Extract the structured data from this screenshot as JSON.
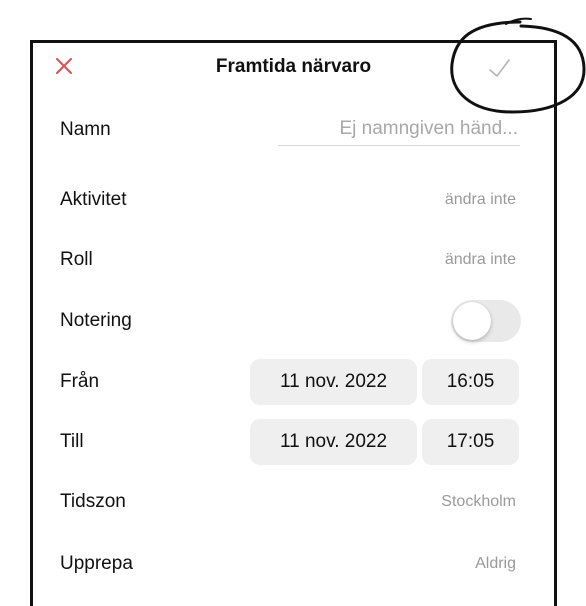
{
  "navbar": {
    "title": "Framtida närvaro",
    "close_icon": "close-icon",
    "confirm_icon": "checkmark-icon",
    "close_color": "#e0504f",
    "confirm_color": "#b5b5b5"
  },
  "form": {
    "name": {
      "label": "Namn",
      "placeholder": "Ej namngiven händ...",
      "value": ""
    },
    "activity": {
      "label": "Aktivitet",
      "value": "ändra inte"
    },
    "role": {
      "label": "Roll",
      "value": "ändra inte"
    },
    "note": {
      "label": "Notering",
      "enabled": false
    },
    "from": {
      "label": "Från",
      "date": "11 nov. 2022",
      "time": "16:05"
    },
    "to": {
      "label": "Till",
      "date": "11 nov. 2022",
      "time": "17:05"
    },
    "timezone": {
      "label": "Tidszon",
      "value": "Stockholm"
    },
    "repeat": {
      "label": "Upprepa",
      "value": "Aldrig"
    }
  },
  "annotation": {
    "type": "hand-drawn-circle",
    "color": "#111111"
  }
}
